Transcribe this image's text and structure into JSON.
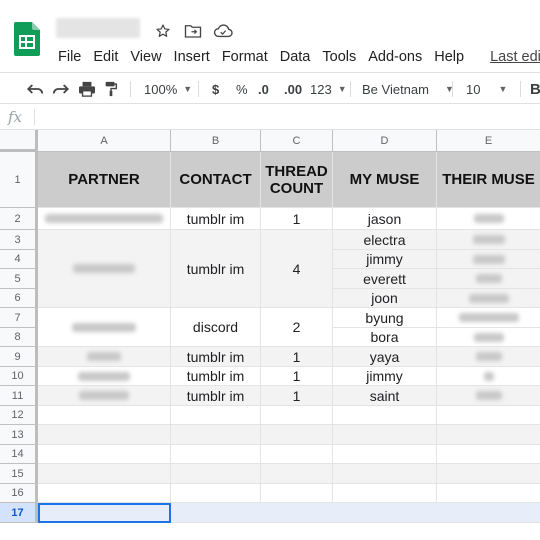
{
  "app": {
    "menu": [
      "File",
      "Edit",
      "View",
      "Insert",
      "Format",
      "Data",
      "Tools",
      "Add-ons",
      "Help"
    ],
    "last_edit": "Last edit wa"
  },
  "toolbar": {
    "zoom": "100%",
    "currency": "$",
    "percent": "%",
    "dec_decrease": ".0",
    "dec_increase": ".00",
    "more_formats": "123",
    "font": "Be Vietnam",
    "font_size": "10",
    "bold": "B"
  },
  "formula_bar": {
    "fx": "fx"
  },
  "columns": [
    "A",
    "B",
    "C",
    "D",
    "E"
  ],
  "rows": [
    "1",
    "2",
    "3",
    "4",
    "5",
    "6",
    "7",
    "8",
    "9",
    "10",
    "11",
    "12",
    "13",
    "14",
    "15",
    "16",
    "17"
  ],
  "headers": {
    "partner": "PARTNER",
    "contact": "CONTACT",
    "thread_count": "THREAD COUNT",
    "my_muse": "MY MUSE",
    "their_muse": "THEIR MUSE"
  },
  "groups": [
    {
      "contact": "tumblr im",
      "count": "1"
    },
    {
      "contact": "tumblr im",
      "count": "4"
    },
    {
      "contact": "discord",
      "count": "2"
    },
    {
      "contact": "tumblr im",
      "count": "1"
    },
    {
      "contact": "tumblr im",
      "count": "1"
    },
    {
      "contact": "tumblr im",
      "count": "1"
    }
  ],
  "muses": [
    "jason",
    "electra",
    "jimmy",
    "everett",
    "joon",
    "byung",
    "bora",
    "yaya",
    "jimmy",
    "saint"
  ]
}
